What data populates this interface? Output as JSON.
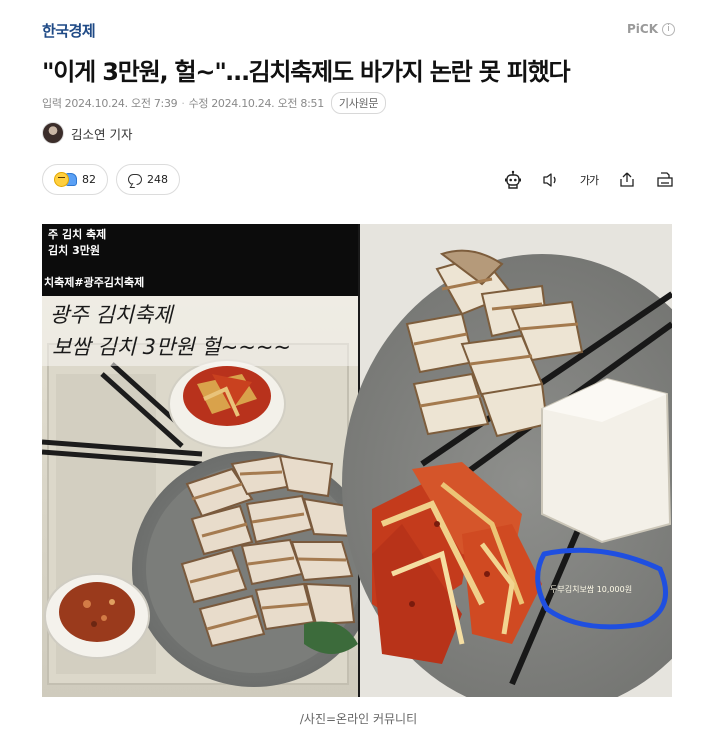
{
  "header": {
    "press_name": "한국경제",
    "pick_label": "PiCK",
    "pick_info_symbol": "i"
  },
  "article": {
    "title": "\"이게 3만원, 헐~\"…김치축제도 바가지 논란 못 피했다",
    "input_label": "입력",
    "input_time": "2024.10.24. 오전 7:39",
    "modified_label": "수정",
    "modified_time": "2024.10.24. 오전 8:51",
    "original_button": "기사원문",
    "reporter": "김소연 기자",
    "reactions_count": "82",
    "comments_count": "248",
    "font_size_label": "가가",
    "photo_caption": "/사진=온라인 커뮤니티"
  },
  "photo": {
    "overlay_lines": [
      "주 김치 축제",
      "김치 3만원",
      "치축제#광주김치축제"
    ],
    "handwriting_lines": [
      "광주 김치축제",
      "보쌈 김치 3만원 헐~~~~"
    ],
    "menu_label": "두부김치보쌈 10,000원"
  },
  "colors": {
    "press": "#1f4a86",
    "circle_marker": "#1f4fe0"
  },
  "icons": [
    "robot-icon",
    "speaker-icon",
    "font-size-icon",
    "share-icon",
    "print-icon",
    "info-icon",
    "comment-icon",
    "reaction-icon"
  ]
}
